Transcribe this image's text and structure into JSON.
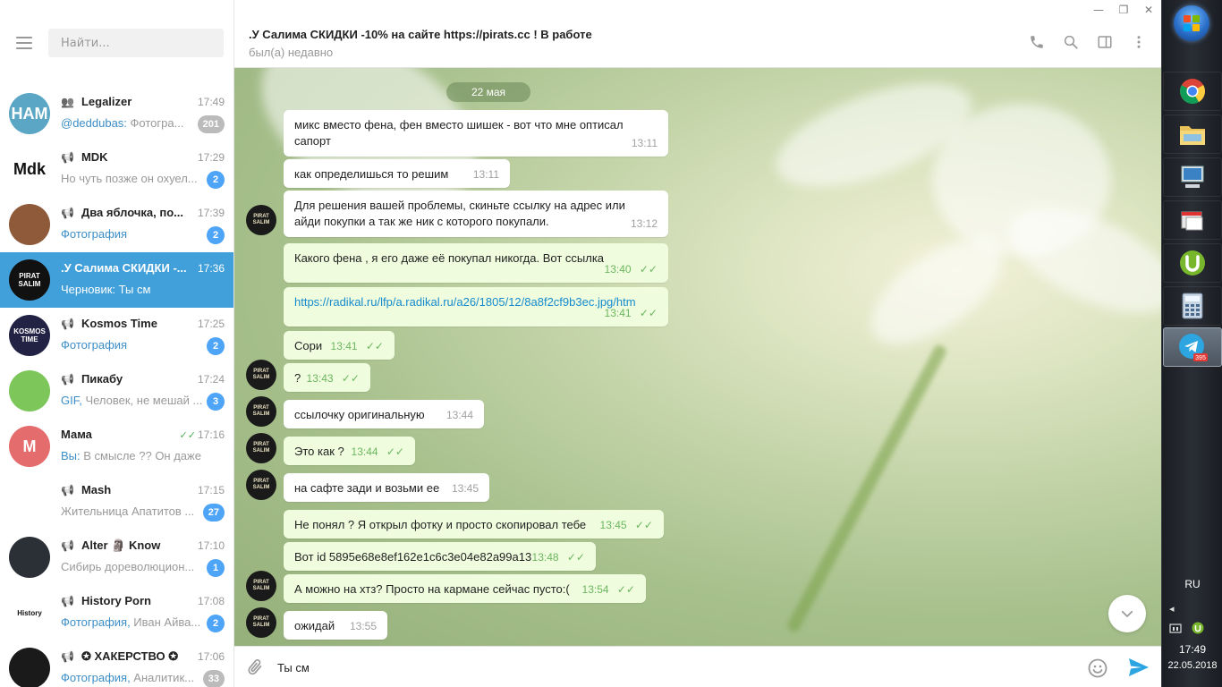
{
  "sidebar": {
    "search_placeholder": "Найти...",
    "chats": [
      {
        "name": "Legalizer",
        "kind": "group",
        "time": "17:49",
        "preview_hl": "@deddubas:",
        "preview": " Фотогра...",
        "badge": "201",
        "badge_muted": true,
        "avatar_color": "#5aa6c4",
        "avatar_text": "HAM"
      },
      {
        "name": "MDK",
        "kind": "channel",
        "time": "17:29",
        "preview_hl": "",
        "preview": "Но чуть позже он охуел...",
        "badge": "2",
        "badge_muted": false,
        "avatar_color": "#ffffff",
        "avatar_text": "Mdk"
      },
      {
        "name": "Два яблочка, по...",
        "kind": "channel",
        "time": "17:39",
        "preview_hl": "Фотография",
        "preview": "",
        "badge": "2",
        "badge_muted": false,
        "avatar_color": "#8e5a3a",
        "avatar_text": ""
      },
      {
        "name": ".У Салима СКИДКИ -...",
        "kind": "",
        "time": "17:36",
        "preview_hl": "",
        "preview": "Черновик: Ты см",
        "badge": "",
        "badge_muted": false,
        "avatar_color": "#111111",
        "avatar_text": "PIRAT SALIM",
        "active": true
      },
      {
        "name": "Kosmos Time",
        "kind": "channel",
        "time": "17:25",
        "preview_hl": "Фотография",
        "preview": "",
        "badge": "2",
        "badge_muted": false,
        "avatar_color": "#222244",
        "avatar_text": "KOSMOS TIME"
      },
      {
        "name": "Пикабу",
        "kind": "channel",
        "time": "17:24",
        "preview_hl": "GIF,",
        "preview": " Человек, не мешай ...",
        "badge": "3",
        "badge_muted": false,
        "avatar_color": "#7cc65a",
        "avatar_text": ""
      },
      {
        "name": "Мама",
        "kind": "",
        "time": "17:16",
        "read": true,
        "preview_hl": "Вы:",
        "preview": " В смысле ?? Он даже не ...",
        "badge": "",
        "badge_muted": false,
        "avatar_color": "#e56c6c",
        "avatar_text": "M"
      },
      {
        "name": "Mash",
        "kind": "channel",
        "time": "17:15",
        "preview_hl": "",
        "preview": "Жительница Апатитов ...",
        "badge": "27",
        "badge_muted": false,
        "avatar_color": "#ffffff",
        "avatar_text": ""
      },
      {
        "name": "Alter 🗿 Know",
        "kind": "channel",
        "time": "17:10",
        "preview_hl": "",
        "preview": "Сибирь дореволюцион...",
        "badge": "1",
        "badge_muted": false,
        "avatar_color": "#2b2f36",
        "avatar_text": ""
      },
      {
        "name": "History Porn",
        "kind": "channel",
        "time": "17:08",
        "preview_hl": "Фотография,",
        "preview": " Иван Айва...",
        "badge": "2",
        "badge_muted": false,
        "avatar_color": "#ffffff",
        "avatar_text": "History"
      },
      {
        "name": "✪ ХАКЕРСТВО ✪",
        "kind": "channel",
        "time": "17:06",
        "preview_hl": "Фотография,",
        "preview": " Аналитик...",
        "badge": "33",
        "badge_muted": true,
        "avatar_color": "#1a1a1a",
        "avatar_text": ""
      }
    ]
  },
  "header": {
    "title": ".У Салима СКИДКИ -10% на сайте https://pirats.cc ! В работе",
    "status": "был(а) недавно"
  },
  "date_chip": "22 мая",
  "messages": [
    {
      "dir": "in",
      "lines": [
        "микс вместо фена, фен вместо шишек - вот что мне оптисал",
        "сапорт"
      ],
      "time": "13:11"
    },
    {
      "dir": "in",
      "lines": [
        "как определишься  то решим"
      ],
      "time": "13:11"
    },
    {
      "dir": "in",
      "lines": [
        "Для решения вашей проблемы, скиньте ссылку на адрес или",
        "айди покупки а так же  ник с которого покупали."
      ],
      "time": "13:12"
    },
    {
      "dir": "out",
      "lines": [
        "Какого фена , я его даже её покупал никогда. Вот ссылка"
      ],
      "time": "13:40"
    },
    {
      "dir": "out",
      "link": "https://radikal.ru/lfp/a.radikal.ru/a26/1805/12/8a8f2cf9b3ec.jpg/htm",
      "time": "13:41"
    },
    {
      "dir": "out",
      "lines": [
        "Сори"
      ],
      "time": "13:41"
    },
    {
      "dir": "out",
      "lines": [
        "?"
      ],
      "time": "13:43"
    },
    {
      "dir": "in",
      "lines": [
        "ссылочку оригинальную"
      ],
      "time": "13:44"
    },
    {
      "dir": "out",
      "lines": [
        "Это как ?"
      ],
      "time": "13:44"
    },
    {
      "dir": "in",
      "lines": [
        "на сафте зади и возьми ее"
      ],
      "time": "13:45"
    },
    {
      "dir": "out",
      "lines": [
        "Не понял ? Я открыл фотку и просто скопировал тебе"
      ],
      "time": "13:45"
    },
    {
      "dir": "out",
      "lines": [
        "Вот id 5895e68e8ef162e1c6c3e04e82a99a13"
      ],
      "time": "13:48"
    },
    {
      "dir": "out",
      "lines": [
        "А можно на хтз? Просто на кармане сейчас пусто:("
      ],
      "time": "13:54"
    },
    {
      "dir": "in",
      "lines": [
        "ожидай"
      ],
      "time": "13:55"
    }
  ],
  "composer": {
    "draft": "Ты см"
  },
  "taskbar": {
    "lang": "RU",
    "time": "17:49",
    "date": "22.05.2018",
    "telegram_badge": "395"
  },
  "colors": {
    "accent": "#419fd9",
    "badge": "#4ea4f6",
    "outgoing": "#effdde",
    "read_check": "#4eb05b"
  }
}
